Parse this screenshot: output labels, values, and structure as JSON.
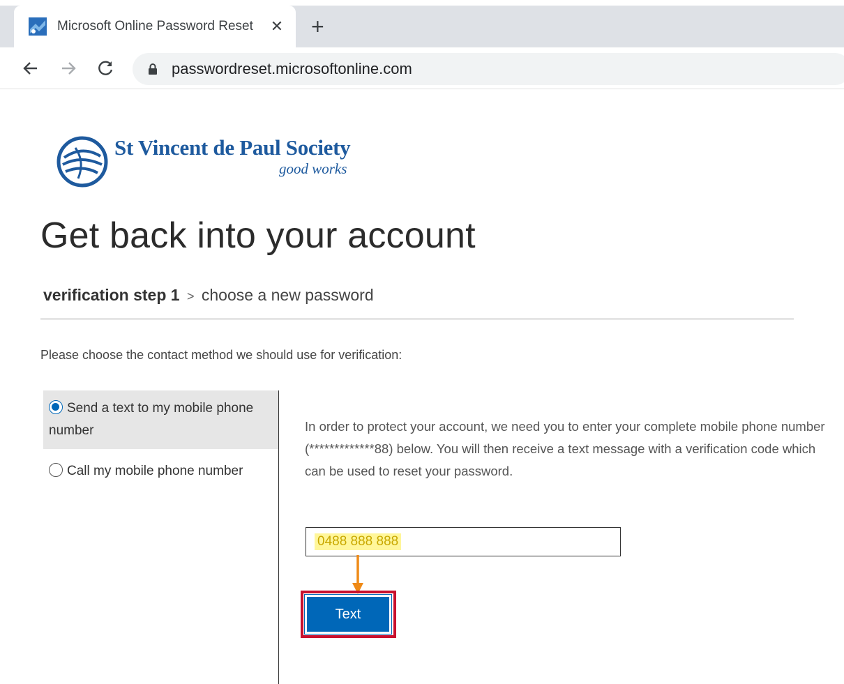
{
  "browser": {
    "tab_title": "Microsoft Online Password Reset",
    "tab_close": "✕",
    "new_tab": "+",
    "url": "passwordreset.microsoftonline.com"
  },
  "logo": {
    "name": "St Vincent de Paul Society",
    "tagline": "good works"
  },
  "page": {
    "title": "Get back into your account",
    "steps": {
      "current": "verification step 1",
      "separator": ">",
      "next": "choose a new password"
    },
    "instruction": "Please choose the contact method we should use for verification:",
    "options": [
      {
        "label": "Send a text to my mobile phone number",
        "selected": true
      },
      {
        "label": "Call my mobile phone number",
        "selected": false
      }
    ],
    "message": "In order to protect your account, we need you to enter your complete mobile phone number (*************88) below. You will then receive a text message with a verification code which can be used to reset your password.",
    "phone_input_value": "0488 888 888",
    "submit_label": "Text"
  },
  "colors": {
    "accent": "#0067b8",
    "brand": "#1e5a9e",
    "highlight_box": "#c8102e",
    "arrow": "#ef8a17",
    "input_highlight": "#fff69a"
  }
}
